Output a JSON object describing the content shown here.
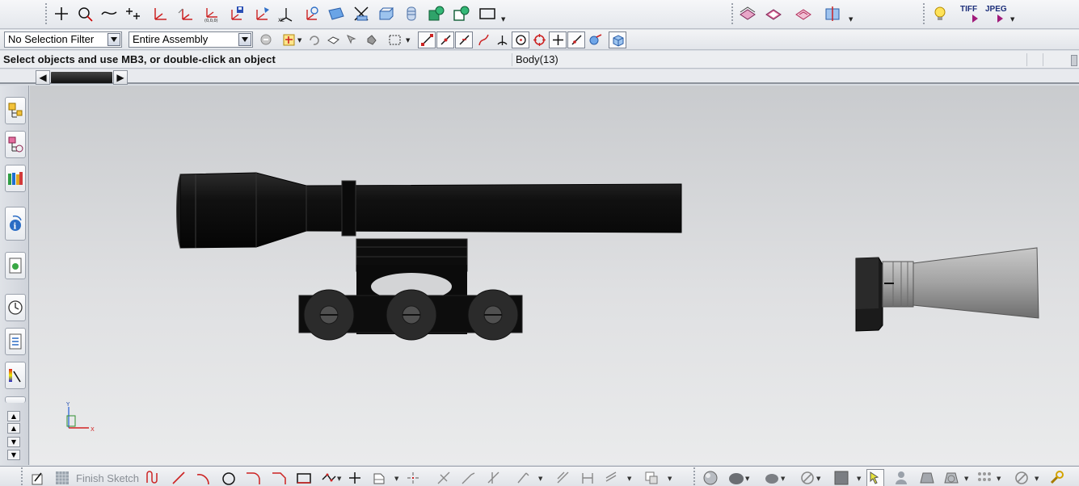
{
  "colors": {
    "accent_red": "#d22222",
    "icon_blue": "#2f6fc7",
    "cad_black": "#0d0d0d",
    "viewport_top": "#c9cbce"
  },
  "toolbar_top": {
    "icons": [
      "point-icon",
      "circle-icon",
      "spline-icon",
      "point-set-icon",
      "datum-csys-icon",
      "offset-csys-icon",
      "origin-csys-icon",
      "save-csys-icon",
      "dynamic-csys-icon",
      "wcs-xc-icon",
      "wcs-orient-icon",
      "face-icon",
      "trim-icon",
      "extrude-icon",
      "cylinder-icon",
      "block-shaded-icon",
      "block-outline-icon",
      "rectangle-icon",
      "section-icon",
      "layer-icon",
      "filter-icon",
      "view-icon",
      "bulb-icon"
    ],
    "tiff_label": "TIFF",
    "jpeg_label": "JPEG"
  },
  "selection_bar": {
    "filter_value": "No Selection Filter",
    "scope_value": "Entire Assembly",
    "snap_icons": [
      "snap-end-icon",
      "snap-mid-icon",
      "snap-control-icon",
      "snap-intersection-icon",
      "snap-arc-icon",
      "snap-center-icon",
      "snap-quadrant-icon",
      "snap-existing-icon",
      "snap-oncurve-icon",
      "snap-pole-icon",
      "snap-solid-icon"
    ]
  },
  "status": {
    "prompt": "Select objects and use MB3, or double-click an object",
    "selection": "Body(13)"
  },
  "resource_bar": [
    "assembly-navigator-icon",
    "constraint-navigator-icon",
    "roles-icon",
    "info-icon",
    "web-icon",
    "history-icon",
    "properties-icon",
    "palette-icon"
  ],
  "triad": {
    "x_label": "X",
    "y_label": "Y"
  },
  "bottom_bar": {
    "finish_sketch_label": "Finish Sketch",
    "icons": [
      "sketch-profile-icon",
      "line-icon",
      "arc-icon",
      "circle-icon",
      "fillet-icon",
      "chamfer-icon",
      "rectangle-icon",
      "polygon-icon",
      "point-icon",
      "studio-spline-icon",
      "offset-icon",
      "trim-icon",
      "extend-icon",
      "corner-icon",
      "mirror-icon",
      "dimension-icon",
      "constraint-icon",
      "shaded-icon",
      "render-icon",
      "hide-icon",
      "edge-icon",
      "layer-icon",
      "wcs-icon"
    ]
  }
}
